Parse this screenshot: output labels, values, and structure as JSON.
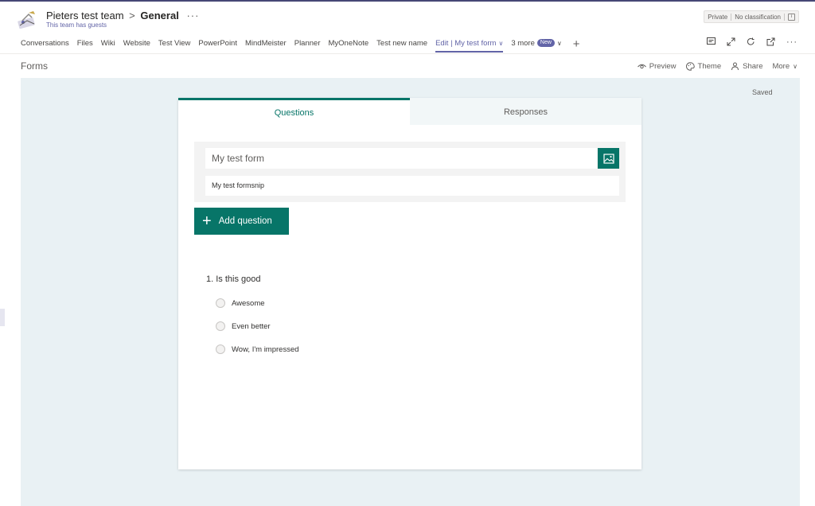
{
  "header": {
    "team": "Pieters test team",
    "separator": ">",
    "channel": "General",
    "more": "···",
    "guests_note": "This team has guests",
    "privacy": "Private",
    "classification": "No classification"
  },
  "tabs": [
    {
      "label": "Conversations"
    },
    {
      "label": "Files"
    },
    {
      "label": "Wiki"
    },
    {
      "label": "Website"
    },
    {
      "label": "Test View"
    },
    {
      "label": "PowerPoint"
    },
    {
      "label": "MindMeister"
    },
    {
      "label": "Planner"
    },
    {
      "label": "MyOneNote"
    },
    {
      "label": "Test new name"
    },
    {
      "label": "Edit | My test form"
    },
    {
      "label": "3 more"
    }
  ],
  "new_badge": "New",
  "forms": {
    "title": "Forms",
    "preview": "Preview",
    "theme": "Theme",
    "share": "Share",
    "more": "More",
    "saved": "Saved"
  },
  "editor": {
    "tab_questions": "Questions",
    "tab_responses": "Responses",
    "form_title": "My test form",
    "form_description": "My test formsnip",
    "add_question": "Add question",
    "question": "1. Is this good",
    "options": [
      "Awesome",
      "Even better",
      "Wow, I'm impressed"
    ]
  },
  "colors": {
    "accent": "#6264a7",
    "forms_green": "#077568",
    "canvas": "#e9f1f4"
  }
}
